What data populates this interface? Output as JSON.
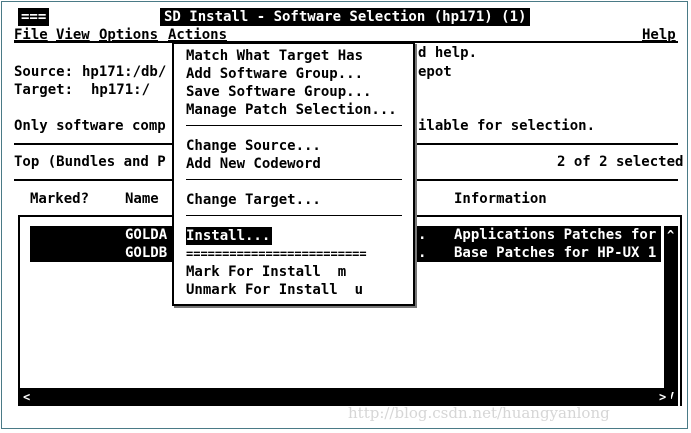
{
  "titlebar": {
    "control": "===",
    "title": "SD Install - Software Selection (hp171) (1)"
  },
  "menubar": {
    "file": "File",
    "view": "View",
    "options": "Options",
    "actions": "Actions",
    "help": "Help"
  },
  "info": {
    "help_text": "d help.",
    "source_label": "Source:",
    "source_value": "hp171:/db/",
    "source_tail": "epot",
    "target_label": "Target:",
    "target_value": "hp171:/",
    "message": "Only software comp",
    "message_tail": "ilable for selection."
  },
  "status": {
    "path": "Top (Bundles and P",
    "count": "2 of 2 selected"
  },
  "table": {
    "columns": {
      "marked": "Marked?",
      "name": "Name",
      "info": "Information"
    },
    "rows": [
      {
        "name": "GOLDA",
        "dot": ".",
        "info": "Applications Patches for"
      },
      {
        "name": "GOLDB",
        "dot": ".",
        "info": "Base Patches for HP-UX 1"
      }
    ]
  },
  "actions_menu": {
    "items": [
      "Match What Target Has",
      "Add Software Group...",
      "Save Software Group...",
      "Manage Patch Selection...",
      "Change Source...",
      "Add New Codeword",
      "Change Target...",
      "Install...",
      "=========================",
      "Mark For Install  m",
      "Unmark For Install  u"
    ]
  },
  "scroll": {
    "left_arrow": "<",
    "right_arrow": ">",
    "up_arrow": "^",
    "down_arrow": "v"
  },
  "watermark": "http://blog.csdn.net/huangyanlong"
}
